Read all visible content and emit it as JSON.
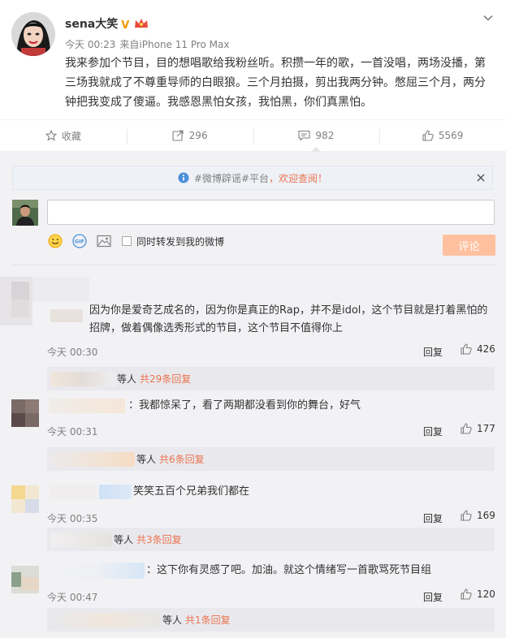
{
  "post": {
    "username": "sena大笑",
    "time": "今天 00:23",
    "source_prefix": "来自",
    "source": "iPhone 11 Pro Max",
    "text": "我来参加个节目，目的想唱歌给我粉丝听。积攒一年的歌，一首没唱，两场没播，第三场我就成了不尊重导师的白眼狼。三个月拍摄，剪出我两分钟。憋屈三个月，两分钟把我变成了傻逼。我感恩黑怕女孩，我怕黑，你们真黑怕。"
  },
  "actions": {
    "favorite": "收藏",
    "repost": "296",
    "comment": "982",
    "like": "5569"
  },
  "notice": {
    "tag": "#微博辟谣#平台",
    "tail": "，欢迎查阅！"
  },
  "composer": {
    "sync_label": "同时转发到我的微博",
    "submit": "评论"
  },
  "comments": [
    {
      "text": "因为你是爱奇艺成名的，因为你是真正的Rap，并不是idol，这个节目就是打着黑怕的招牌，做着偶像选秀形式的节目，这个节目不值得你上",
      "time": "今天 00:30",
      "reply": "回复",
      "likes": "426",
      "sub_prefix": "等人",
      "sub_more": "共29条回复"
    },
    {
      "text": "：我都惊呆了，看了两期都没看到你的舞台，好气",
      "time": "今天 00:31",
      "reply": "回复",
      "likes": "177",
      "sub_prefix": "等人",
      "sub_more": "共6条回复"
    },
    {
      "text": "笑笑五百个兄弟我们都在",
      "time": "今天 00:35",
      "reply": "回复",
      "likes": "169",
      "sub_prefix": "等人",
      "sub_more": "共3条回复"
    },
    {
      "text": "：这下你有灵感了吧。加油。就这个情绪写一首歌骂死节目组",
      "time": "今天 00:47",
      "reply": "回复",
      "likes": "120",
      "sub_prefix": "等人",
      "sub_more": "共1条回复"
    }
  ],
  "colors": {
    "accent": "#eb7350",
    "verified": "#f39800",
    "submit_bg": "#ffc09f",
    "link_blue": "#4a90d9"
  }
}
